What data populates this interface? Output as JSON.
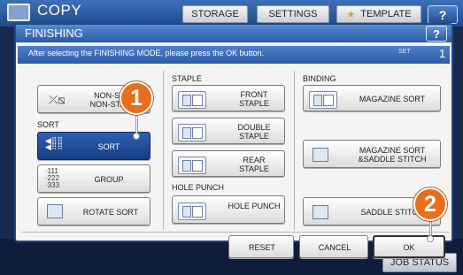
{
  "app": {
    "title": "COPY"
  },
  "top_tabs": [
    "STORAGE",
    "SETTINGS",
    "TEMPLATE"
  ],
  "help_label": "?",
  "dialog": {
    "title": "FINISHING",
    "help_label": "?",
    "instruction": "After selecting the FINISHING MODE, please press the OK button.",
    "set_label": "SET",
    "set_value": "1"
  },
  "buttons": {
    "non_sort": "NON-SORT NON-STAPLE",
    "sort_header": "SORT",
    "sort": "SORT",
    "group": "GROUP",
    "rotate_sort": "ROTATE SORT",
    "staple_header": "STAPLE",
    "front_staple": "FRONT STAPLE",
    "double_staple": "DOUBLE STAPLE",
    "rear_staple": "REAR STAPLE",
    "hole_punch_header": "HOLE PUNCH",
    "hole_punch": "HOLE PUNCH",
    "binding_header": "BINDING",
    "magazine_sort": "MAGAZINE SORT",
    "magazine_sort_saddle": "MAGAZINE SORT &SADDLE STITCH",
    "saddle_stitch": "SADDLE STITCH",
    "reset": "RESET",
    "cancel": "CANCEL",
    "ok": "OK"
  },
  "selected": "sort",
  "callouts": [
    "1",
    "2"
  ],
  "bottom": {
    "job_status": "JOB STATUS"
  },
  "colors": {
    "accent": "#2a5aa6",
    "selected": "#1f4a92",
    "callout": "#e76f1b"
  }
}
